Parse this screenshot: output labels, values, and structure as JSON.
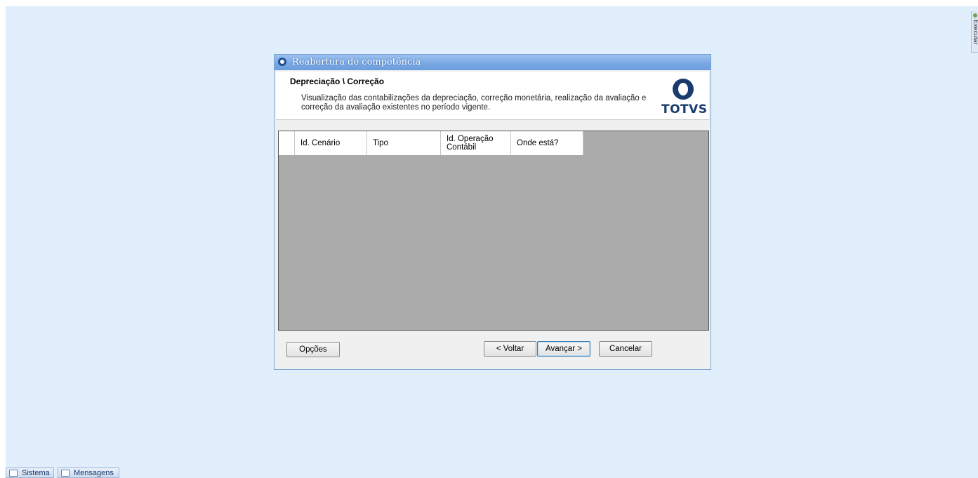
{
  "side_tab": {
    "label": "Executar"
  },
  "dialog": {
    "title": "Reabertura de competência",
    "heading": "Depreciação \\ Correção",
    "description": "Visualização das contabilizações da depreciação, correção monetária, realização da avaliação e correção da avaliação existentes no período vigente.",
    "logo_text": "TOTVS",
    "grid": {
      "columns": [
        "Id. Cenário",
        "Tipo",
        "Id. Operação Contábil",
        "Onde está?"
      ],
      "rows": []
    },
    "buttons": {
      "options": "Opções",
      "back": "< Voltar",
      "next": "Avançar >",
      "cancel": "Cancelar"
    }
  },
  "taskbar": {
    "items": [
      {
        "label": "Sistema",
        "icon": "monitor-icon"
      },
      {
        "label": "Mensagens",
        "icon": "document-icon"
      }
    ]
  },
  "colors": {
    "desktop": "#e1eefb",
    "titlebar": "#7aa9e4",
    "grid_bg": "#ababab",
    "brand": "#1a3b6e"
  }
}
